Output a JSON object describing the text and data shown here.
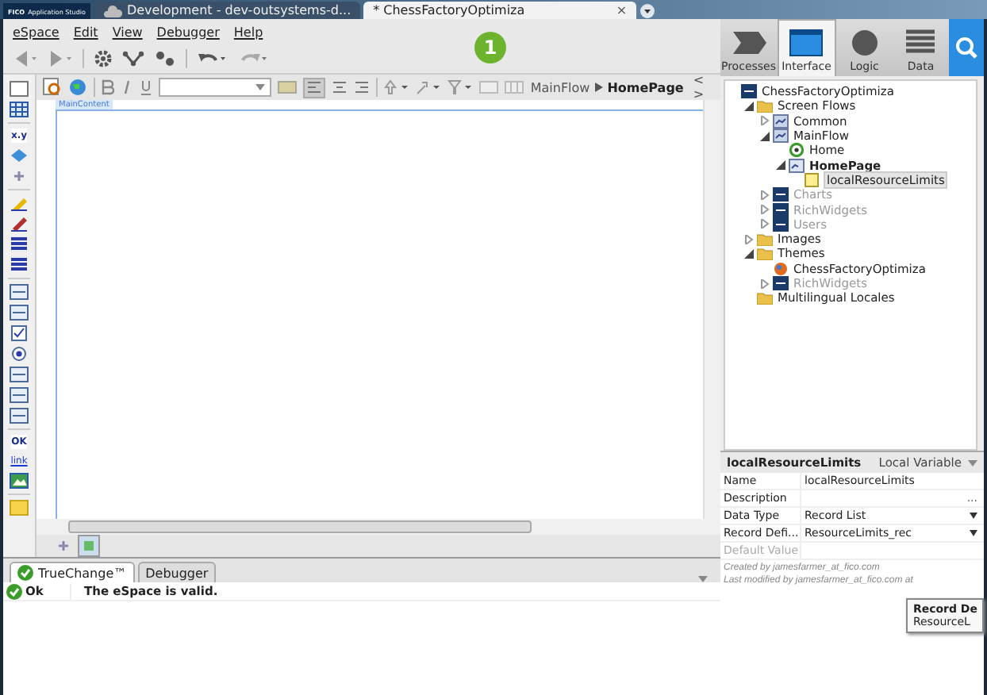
{
  "app_badge": {
    "brand": "FICO",
    "product": "Application Studio"
  },
  "browser_tabs": [
    {
      "label": "Development - dev-outsystems-d...",
      "selected": false,
      "kind": "cloud"
    },
    {
      "label": "* ChessFactoryOptimiza",
      "selected": true,
      "kind": "plain",
      "close": "×"
    }
  ],
  "menu": [
    "eSpace",
    "Edit",
    "View",
    "Debugger",
    "Help"
  ],
  "step_badge": "1",
  "layer_tabs": [
    {
      "label": "Processes",
      "selected": false,
      "kind": "processes"
    },
    {
      "label": "Interface",
      "selected": true,
      "kind": "interface"
    },
    {
      "label": "Logic",
      "selected": false,
      "kind": "logic"
    },
    {
      "label": "Data",
      "selected": false,
      "kind": "data"
    }
  ],
  "breadcrumb": {
    "parent": "MainFlow",
    "current": "HomePage",
    "toggle": "< >"
  },
  "canvas": {
    "container_label": "MainContent"
  },
  "toolbox": [
    {
      "kind": "container"
    },
    {
      "kind": "table"
    },
    {
      "kind": "sep"
    },
    {
      "kind": "text",
      "label": "x.y"
    },
    {
      "kind": "diamond"
    },
    {
      "kind": "small"
    },
    {
      "kind": "sep"
    },
    {
      "kind": "pen"
    },
    {
      "kind": "pen2"
    },
    {
      "kind": "list"
    },
    {
      "kind": "list"
    },
    {
      "kind": "sep"
    },
    {
      "kind": "box"
    },
    {
      "kind": "box"
    },
    {
      "kind": "check"
    },
    {
      "kind": "radio"
    },
    {
      "kind": "box"
    },
    {
      "kind": "box"
    },
    {
      "kind": "box"
    },
    {
      "kind": "sep"
    },
    {
      "kind": "text",
      "label": "OK"
    },
    {
      "kind": "link",
      "label": "link"
    },
    {
      "kind": "image"
    },
    {
      "kind": "sep"
    },
    {
      "kind": "note"
    }
  ],
  "tree": [
    {
      "label": "ChessFactoryOptimiza",
      "kind": "module",
      "selected": false,
      "disabled": false,
      "bold": false,
      "children": [
        {
          "label": "Screen Flows",
          "kind": "folder",
          "expanded": true,
          "selected": false,
          "disabled": false,
          "bold": false,
          "children": [
            {
              "label": "Common",
              "kind": "flow",
              "expanded": false,
              "selected": false,
              "disabled": false,
              "bold": false
            },
            {
              "label": "MainFlow",
              "kind": "flow",
              "expanded": true,
              "selected": false,
              "disabled": false,
              "bold": false,
              "children": [
                {
                  "label": "Home",
                  "kind": "home",
                  "selected": false,
                  "disabled": false,
                  "bold": false
                },
                {
                  "label": "HomePage",
                  "kind": "screen",
                  "expanded": true,
                  "selected": false,
                  "disabled": false,
                  "bold": true,
                  "children": [
                    {
                      "label": "localResourceLimits",
                      "kind": "variable",
                      "selected": true,
                      "disabled": false,
                      "bold": false
                    }
                  ]
                }
              ]
            },
            {
              "label": "Charts",
              "kind": "module",
              "expanded": false,
              "selected": false,
              "disabled": true,
              "bold": false
            },
            {
              "label": "RichWidgets",
              "kind": "module",
              "expanded": false,
              "selected": false,
              "disabled": true,
              "bold": false
            },
            {
              "label": "Users",
              "kind": "module",
              "expanded": false,
              "selected": false,
              "disabled": true,
              "bold": false
            }
          ]
        },
        {
          "label": "Images",
          "kind": "folder",
          "expanded": false,
          "selected": false,
          "disabled": false,
          "bold": false
        },
        {
          "label": "Themes",
          "kind": "folder",
          "expanded": true,
          "selected": false,
          "disabled": false,
          "bold": false,
          "children": [
            {
              "label": "ChessFactoryOptimiza",
              "kind": "theme",
              "selected": false,
              "disabled": false,
              "bold": false
            },
            {
              "label": "RichWidgets",
              "kind": "module",
              "expanded": false,
              "selected": false,
              "disabled": true,
              "bold": false
            }
          ]
        },
        {
          "label": "Multilingual Locales",
          "kind": "folder",
          "selected": false,
          "disabled": false,
          "bold": false
        }
      ]
    }
  ],
  "properties": {
    "title": "localResourceLimits",
    "type": "Local Variable",
    "rows": [
      {
        "name": "Name",
        "value": "localResourceLimits",
        "kind": "text",
        "disabled": false
      },
      {
        "name": "Description",
        "value": "...",
        "kind": "ellipsis",
        "disabled": false
      },
      {
        "name": "Data Type",
        "value": "Record List",
        "kind": "dropdown",
        "disabled": false
      },
      {
        "name": "Record Defi...",
        "value": "ResourceLimits_rec",
        "kind": "dropdown",
        "disabled": false
      },
      {
        "name": "Default Value",
        "kind": "text",
        "disabled": true
      }
    ],
    "created": "Created by jamesfarmer_at_fico.com",
    "modified": "Last modified by jamesfarmer_at_fico.com at"
  },
  "tooltip": {
    "title": "Record De",
    "text": "ResourceL"
  },
  "bottom_tabs": [
    {
      "label": "TrueChange™",
      "selected": true,
      "kind": "check"
    },
    {
      "label": "Debugger",
      "selected": false,
      "kind": "plain"
    }
  ],
  "messages": [
    {
      "status": "Ok",
      "text": "The eSpace is valid.",
      "kind": "ok"
    }
  ]
}
